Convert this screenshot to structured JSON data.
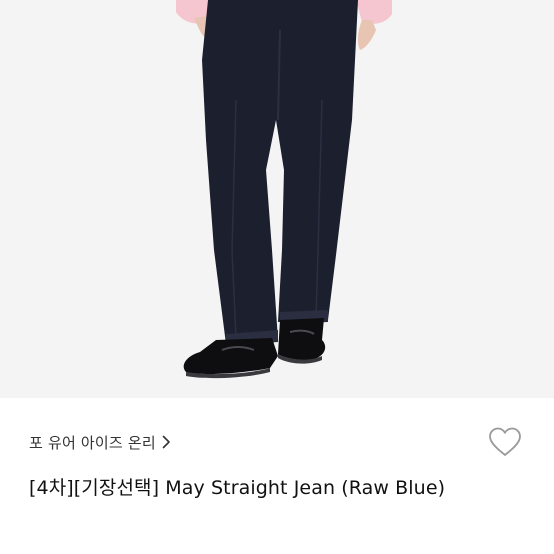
{
  "product": {
    "image_alt": "model wearing raw blue straight jeans with black leather loafers",
    "brand": "포 유어 아이즈 온리",
    "title": "[4차][기장선택] May Straight Jean (Raw Blue)"
  },
  "icons": {
    "brand_chevron": "chevron-right-icon",
    "wishlist": "heart-outline-icon"
  },
  "colors": {
    "background": "#ffffff",
    "image_background": "#f4f4f5",
    "denim": "#1c1f2e",
    "text_primary": "#111111",
    "text_secondary": "#333333",
    "icon_gray": "#9a9a9a"
  }
}
